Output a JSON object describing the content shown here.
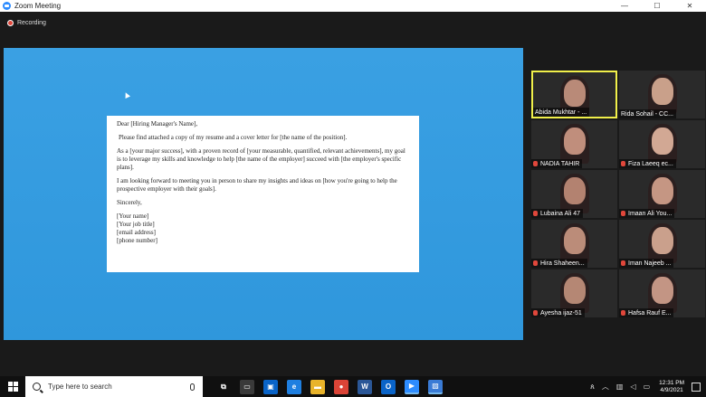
{
  "window": {
    "title": "Zoom Meeting",
    "min_glyph": "—",
    "max_glyph": "☐",
    "close_glyph": "✕",
    "icon": "zoom-logo"
  },
  "recording": {
    "label": "Recording"
  },
  "letter": {
    "salutation": "Dear [Hiring Manager's Name],",
    "p1": "Please find attached a copy of my resume and a cover letter for [the name of the position].",
    "p2": "As a [your major success], with a proven record of [your measurable, quantified, relevant achievements], my goal is to leverage my skills and knowledge to help [the name of the employer] succeed with [the employer's specific plans].",
    "p3": "I am looking forward to meeting you in person to share my insights and ideas on [how you're going to help the prospective employer with their goals].",
    "closing": "Sincerely,",
    "sig": [
      "[Your name]",
      "[Your job title]",
      "[email address]",
      "[phone number]"
    ]
  },
  "participants": [
    {
      "name": "Abida Mukhtar - ...",
      "active": true,
      "muted": false
    },
    {
      "name": "Rida Sohail - CC...",
      "active": false,
      "muted": false
    },
    {
      "name": "NADIA TAHIR",
      "active": false,
      "muted": true
    },
    {
      "name": "Fiza Laeeq ec...",
      "active": false,
      "muted": true
    },
    {
      "name": "Lubaina Ali 47",
      "active": false,
      "muted": true
    },
    {
      "name": "Imaan Ali You...",
      "active": false,
      "muted": true
    },
    {
      "name": "Hira Shaheen...",
      "active": false,
      "muted": true
    },
    {
      "name": "Iman Najeeb ...",
      "active": false,
      "muted": true
    },
    {
      "name": "Ayesha ijaz-51",
      "active": false,
      "muted": true
    },
    {
      "name": "Hafsa Rauf E...",
      "active": false,
      "muted": true
    }
  ],
  "taskbar": {
    "search_placeholder": "Type here to search",
    "apps": [
      {
        "name": "task-view-icon",
        "glyph": "⧉",
        "color": "#101010"
      },
      {
        "name": "terminal-icon",
        "glyph": "▭",
        "color": "#3a3a3a"
      },
      {
        "name": "store-icon",
        "glyph": "▣",
        "color": "#0a64c8"
      },
      {
        "name": "edge-icon",
        "glyph": "e",
        "color": "#1f7fe0"
      },
      {
        "name": "file-explorer-icon",
        "glyph": "▬",
        "color": "#e8b32a"
      },
      {
        "name": "chrome-icon",
        "glyph": "●",
        "color": "#db4437"
      },
      {
        "name": "word-icon",
        "glyph": "W",
        "color": "#2b5797"
      },
      {
        "name": "outlook-icon",
        "glyph": "O",
        "color": "#0a64c8"
      },
      {
        "name": "zoom-icon",
        "glyph": "▶",
        "color": "#2d8cff"
      },
      {
        "name": "photos-icon",
        "glyph": "▨",
        "color": "#3a7bd5"
      }
    ],
    "time": "12:31 PM",
    "date": "4/9/2021",
    "notification_count": "1"
  },
  "colors": {
    "share_bg": "#3aa0e3",
    "active_border": "#f0ef4a",
    "muted": "#e0473b"
  }
}
